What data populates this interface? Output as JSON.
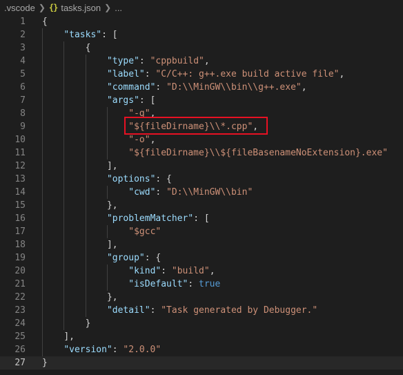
{
  "breadcrumb": {
    "folder": ".vscode",
    "icon": "json-braces-icon",
    "file": "tasks.json",
    "more": "..."
  },
  "editor": {
    "current_line": 27,
    "lines": [
      {
        "n": "1",
        "indent": 0,
        "tokens": [
          {
            "t": "p",
            "v": "{"
          }
        ]
      },
      {
        "n": "2",
        "indent": 1,
        "tokens": [
          {
            "t": "k",
            "v": "\"tasks\""
          },
          {
            "t": "p",
            "v": ": ["
          }
        ]
      },
      {
        "n": "3",
        "indent": 2,
        "tokens": [
          {
            "t": "p",
            "v": "{"
          }
        ]
      },
      {
        "n": "4",
        "indent": 3,
        "tokens": [
          {
            "t": "k",
            "v": "\"type\""
          },
          {
            "t": "p",
            "v": ": "
          },
          {
            "t": "s",
            "v": "\"cppbuild\""
          },
          {
            "t": "p",
            "v": ","
          }
        ]
      },
      {
        "n": "5",
        "indent": 3,
        "tokens": [
          {
            "t": "k",
            "v": "\"label\""
          },
          {
            "t": "p",
            "v": ": "
          },
          {
            "t": "s",
            "v": "\"C/C++: g++.exe build active file\""
          },
          {
            "t": "p",
            "v": ","
          }
        ]
      },
      {
        "n": "6",
        "indent": 3,
        "tokens": [
          {
            "t": "k",
            "v": "\"command\""
          },
          {
            "t": "p",
            "v": ": "
          },
          {
            "t": "s",
            "v": "\"D:\\\\MinGW\\\\bin\\\\g++.exe\""
          },
          {
            "t": "p",
            "v": ","
          }
        ]
      },
      {
        "n": "7",
        "indent": 3,
        "tokens": [
          {
            "t": "k",
            "v": "\"args\""
          },
          {
            "t": "p",
            "v": ": ["
          }
        ]
      },
      {
        "n": "8",
        "indent": 4,
        "tokens": [
          {
            "t": "s",
            "v": "\"-g\""
          },
          {
            "t": "p",
            "v": ","
          }
        ]
      },
      {
        "n": "9",
        "indent": 4,
        "tokens": [
          {
            "t": "s",
            "v": "\"${fileDirname}\\\\*.cpp\""
          },
          {
            "t": "p",
            "v": ","
          }
        ]
      },
      {
        "n": "10",
        "indent": 4,
        "tokens": [
          {
            "t": "s",
            "v": "\"-o\""
          },
          {
            "t": "p",
            "v": ","
          }
        ]
      },
      {
        "n": "11",
        "indent": 4,
        "tokens": [
          {
            "t": "s",
            "v": "\"${fileDirname}\\\\${fileBasenameNoExtension}.exe\""
          }
        ]
      },
      {
        "n": "12",
        "indent": 3,
        "tokens": [
          {
            "t": "p",
            "v": "],"
          }
        ]
      },
      {
        "n": "13",
        "indent": 3,
        "tokens": [
          {
            "t": "k",
            "v": "\"options\""
          },
          {
            "t": "p",
            "v": ": {"
          }
        ]
      },
      {
        "n": "14",
        "indent": 4,
        "tokens": [
          {
            "t": "k",
            "v": "\"cwd\""
          },
          {
            "t": "p",
            "v": ": "
          },
          {
            "t": "s",
            "v": "\"D:\\\\MinGW\\\\bin\""
          }
        ]
      },
      {
        "n": "15",
        "indent": 3,
        "tokens": [
          {
            "t": "p",
            "v": "},"
          }
        ]
      },
      {
        "n": "16",
        "indent": 3,
        "tokens": [
          {
            "t": "k",
            "v": "\"problemMatcher\""
          },
          {
            "t": "p",
            "v": ": ["
          }
        ]
      },
      {
        "n": "17",
        "indent": 4,
        "tokens": [
          {
            "t": "s",
            "v": "\"$gcc\""
          }
        ]
      },
      {
        "n": "18",
        "indent": 3,
        "tokens": [
          {
            "t": "p",
            "v": "],"
          }
        ]
      },
      {
        "n": "19",
        "indent": 3,
        "tokens": [
          {
            "t": "k",
            "v": "\"group\""
          },
          {
            "t": "p",
            "v": ": {"
          }
        ]
      },
      {
        "n": "20",
        "indent": 4,
        "tokens": [
          {
            "t": "k",
            "v": "\"kind\""
          },
          {
            "t": "p",
            "v": ": "
          },
          {
            "t": "s",
            "v": "\"build\""
          },
          {
            "t": "p",
            "v": ","
          }
        ]
      },
      {
        "n": "21",
        "indent": 4,
        "tokens": [
          {
            "t": "k",
            "v": "\"isDefault\""
          },
          {
            "t": "p",
            "v": ": "
          },
          {
            "t": "b",
            "v": "true"
          }
        ]
      },
      {
        "n": "22",
        "indent": 3,
        "tokens": [
          {
            "t": "p",
            "v": "},"
          }
        ]
      },
      {
        "n": "23",
        "indent": 3,
        "tokens": [
          {
            "t": "k",
            "v": "\"detail\""
          },
          {
            "t": "p",
            "v": ": "
          },
          {
            "t": "s",
            "v": "\"Task generated by Debugger.\""
          }
        ]
      },
      {
        "n": "24",
        "indent": 2,
        "tokens": [
          {
            "t": "p",
            "v": "}"
          }
        ]
      },
      {
        "n": "25",
        "indent": 1,
        "tokens": [
          {
            "t": "p",
            "v": "],"
          }
        ]
      },
      {
        "n": "26",
        "indent": 1,
        "tokens": [
          {
            "t": "k",
            "v": "\"version\""
          },
          {
            "t": "p",
            "v": ": "
          },
          {
            "t": "s",
            "v": "\"2.0.0\""
          }
        ]
      },
      {
        "n": "27",
        "indent": 0,
        "tokens": [
          {
            "t": "p",
            "v": "}"
          }
        ]
      }
    ]
  },
  "colors": {
    "background": "#1e1e1e",
    "key": "#9cdcfe",
    "string": "#ce9178",
    "boolean": "#569cd6",
    "highlight_box": "#e81123"
  }
}
